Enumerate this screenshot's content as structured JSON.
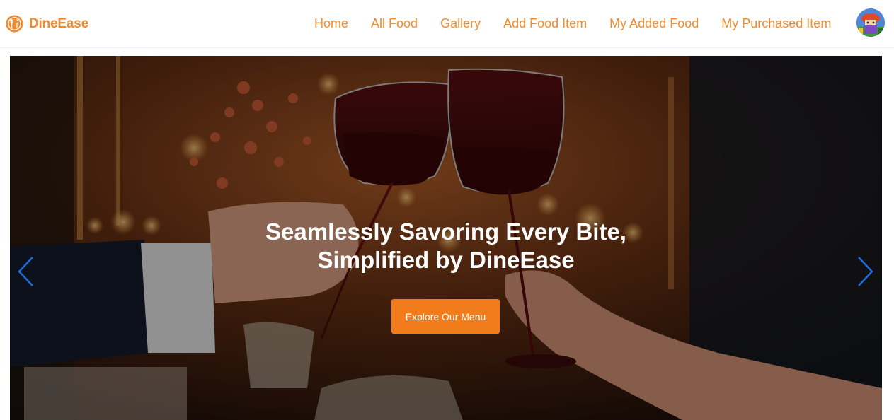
{
  "brand": {
    "name": "DineEase",
    "logo_icon": "restaurant-logo-icon",
    "color": "#f28a2e"
  },
  "nav": {
    "links": [
      {
        "label": "Home"
      },
      {
        "label": "All Food"
      },
      {
        "label": "Gallery"
      },
      {
        "label": "Add Food Item"
      },
      {
        "label": "My Added Food"
      },
      {
        "label": "My Purchased Item"
      }
    ],
    "avatar_icon": "user-avatar"
  },
  "hero": {
    "title_line1": "Seamlessly Savoring Every Bite,",
    "title_line2": "Simplified by DineEase",
    "cta_label": "Explore Our Menu",
    "cta_color": "#f27b1b",
    "prev_icon": "chevron-left-icon",
    "next_icon": "chevron-right-icon",
    "arrow_color": "#1b6fe0",
    "image_subject": "two hands toasting glasses of red wine in a warm-lit restaurant"
  }
}
